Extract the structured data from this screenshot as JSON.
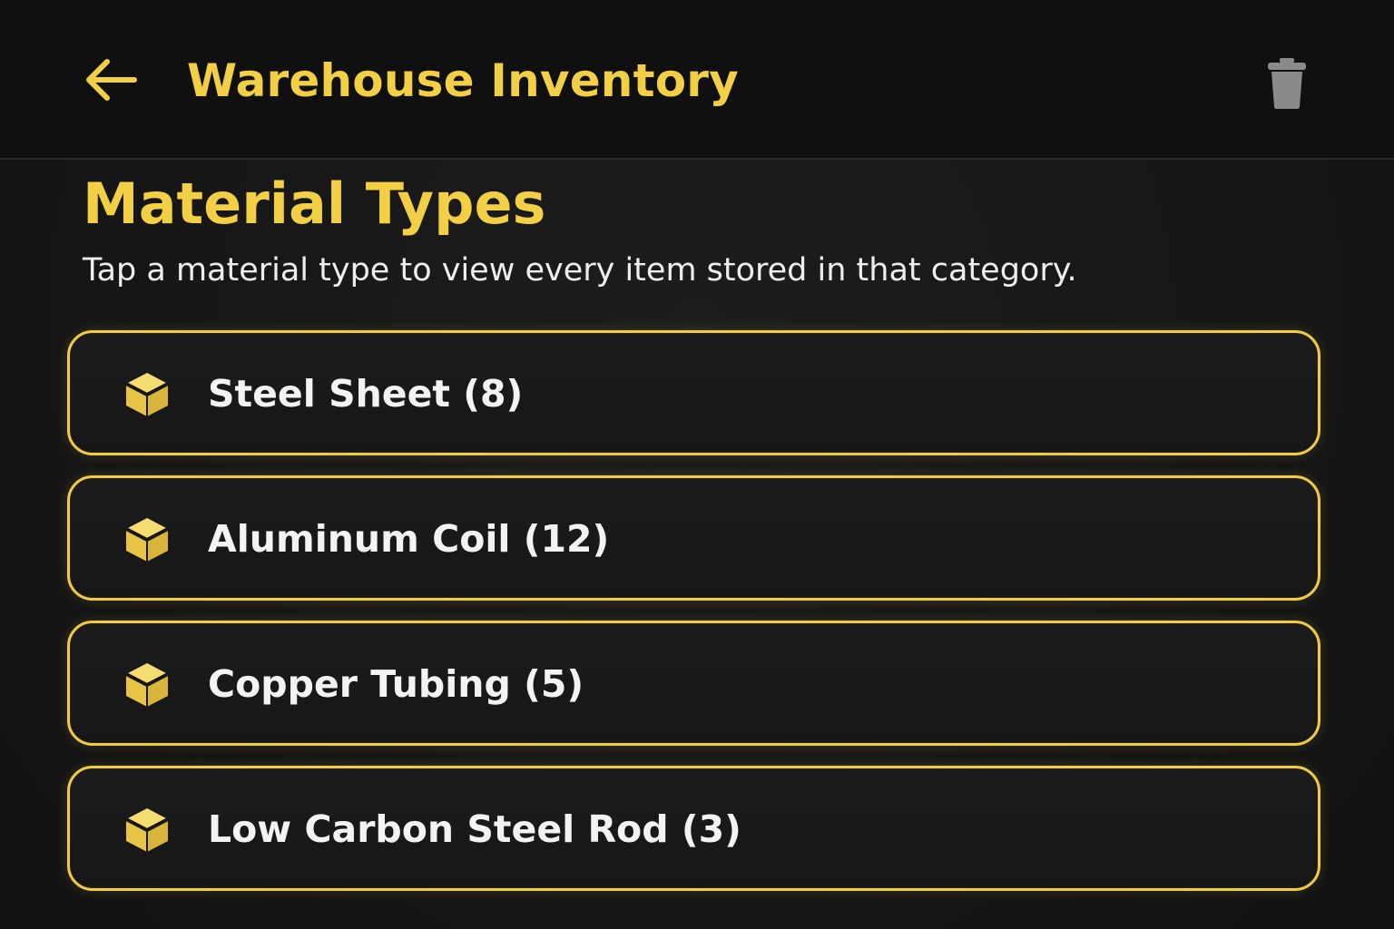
{
  "header": {
    "title": "Warehouse Inventory",
    "back_icon": "arrow-left-icon",
    "trash_icon": "trash-icon"
  },
  "main": {
    "section_title": "Material Types",
    "section_subtitle": "Tap a material type to view every item stored in that category.",
    "materials": [
      {
        "label": "Steel Sheet (8)",
        "icon": "box-icon"
      },
      {
        "label": "Aluminum Coil (12)",
        "icon": "box-icon"
      },
      {
        "label": "Copper Tubing (5)",
        "icon": "box-icon"
      },
      {
        "label": "Low Carbon Steel Rod (3)",
        "icon": "box-icon"
      }
    ]
  },
  "colors": {
    "accent": "#f2cf45",
    "border": "#f0cb49",
    "header_bg": "#101010",
    "background": "#171717",
    "text": "#f1f1f1",
    "trash": "#8a8a8a"
  }
}
